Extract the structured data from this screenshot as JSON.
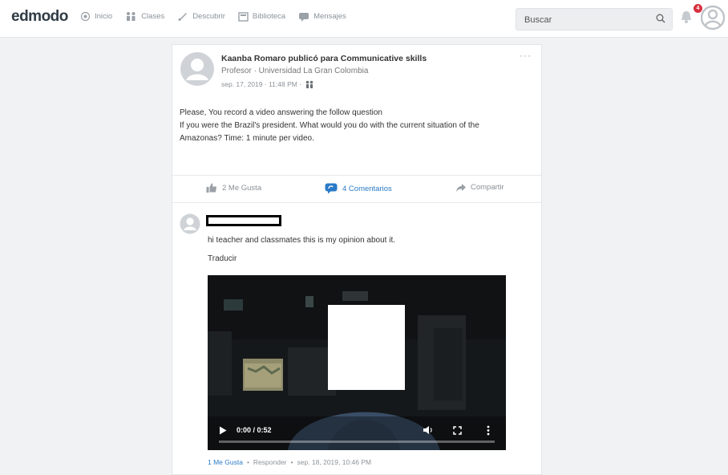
{
  "app": {
    "logo": "edmodo"
  },
  "nav": {
    "items": [
      {
        "label": "Inicio",
        "icon": "home-icon"
      },
      {
        "label": "Clases",
        "icon": "classes-icon"
      },
      {
        "label": "Descubrir",
        "icon": "rocket-icon"
      },
      {
        "label": "Biblioteca",
        "icon": "library-icon"
      },
      {
        "label": "Mensajes",
        "icon": "message-icon"
      }
    ]
  },
  "search": {
    "placeholder": "Buscar"
  },
  "notifications": {
    "count": "4"
  },
  "post": {
    "title": "Kaanba Romaro publicó para Communicative skills",
    "subtitle": "Profesor · Universidad La Gran Colombia",
    "timestamp": "sep. 17, 2019 · 11:48 PM ·",
    "more": "···",
    "body": [
      "Please, You record a video answering the follow question",
      "If you were the Brazil's president. What would you do with the current situation of the",
      "Amazonas? Time: 1 minute per video."
    ],
    "actions": {
      "like": "2 Me Gusta",
      "comments": "4 Comentarios",
      "share": "Compartir"
    }
  },
  "comment": {
    "text": "hi teacher and classmates this is my opinion about it.",
    "translate": "Traducir",
    "video": {
      "time": "0:00 / 0:52",
      "progress": 0
    },
    "footer": {
      "like": "1 Me Gusta",
      "reply": "Responder",
      "date": "sep. 18, 2019, 10:46 PM",
      "sep": "•"
    }
  },
  "colors": {
    "accent": "#2a7ac7",
    "badge": "#d9303e"
  }
}
